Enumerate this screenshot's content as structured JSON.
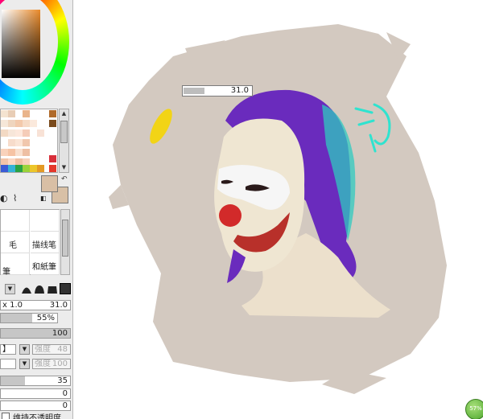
{
  "tooltip": {
    "brush_size": "31.0"
  },
  "panel": {
    "brush_labels": [
      "毛",
      "描线笔",
      "和紙筆"
    ],
    "brush_extra": "筆",
    "brush_size": {
      "multiplier": "x 1.0",
      "value": "31.0"
    },
    "min_size": {
      "value": "55%",
      "fraction": 0.55
    },
    "density": {
      "value": "100",
      "fraction": 1.0
    },
    "strength1": {
      "left": "】",
      "label": "强度",
      "value": "48"
    },
    "strength2": {
      "label": "强度",
      "value": "100"
    },
    "blend": {
      "value": "35",
      "fraction": 0.35
    },
    "dilution": {
      "value": "0"
    },
    "persistence": {
      "value": "0"
    },
    "keep_opacity": "维持不透明度"
  },
  "zoom": {
    "label": "57%"
  },
  "colors": {
    "foreground": "#d9bfa5",
    "background": "#d8c0a6",
    "canvas_bg": "#ffffff",
    "smear": "#d3c9c0"
  },
  "icons": {
    "swap": "swap-arrow-icon",
    "eyedropper": "eyedropper-icon",
    "brush": "brush-icon"
  }
}
